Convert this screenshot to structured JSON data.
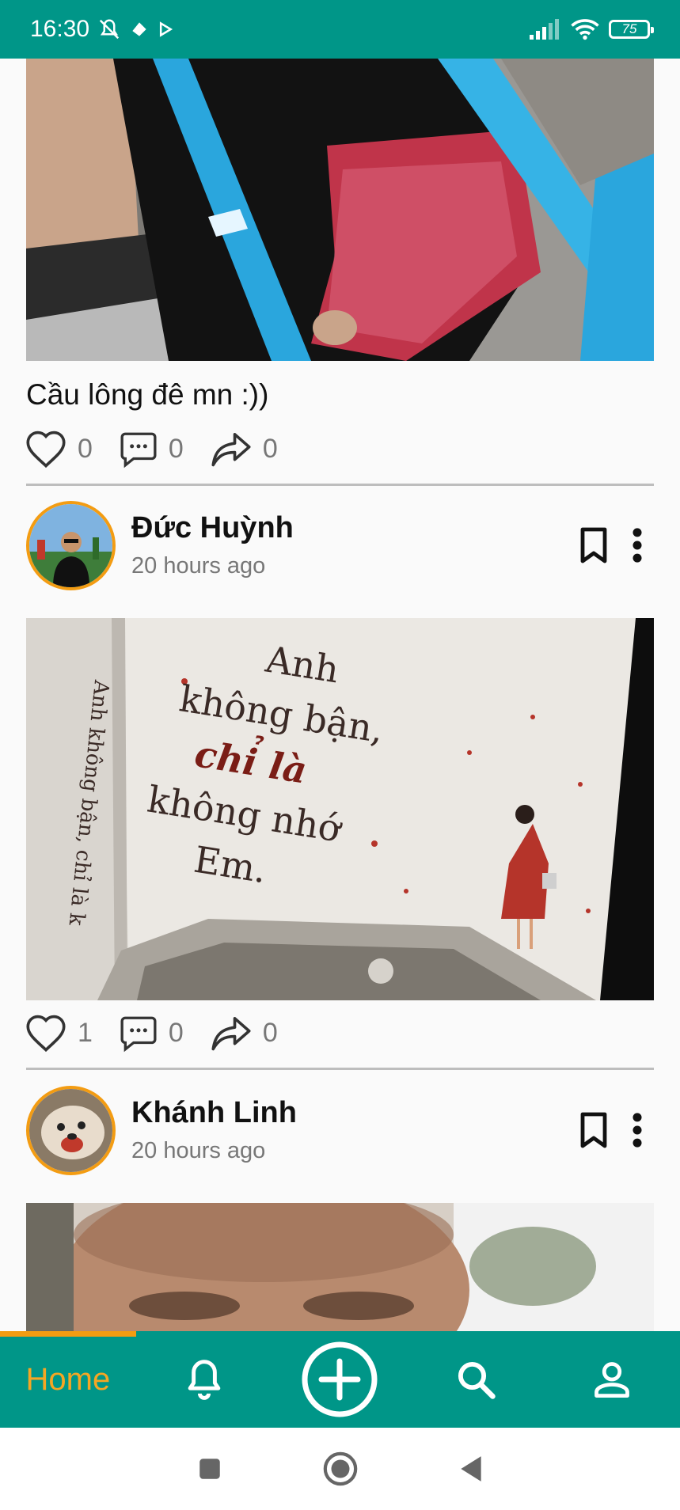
{
  "status_bar": {
    "time": "16:30",
    "battery": "75",
    "icons": [
      "mute-icon",
      "app-icon",
      "play-icon",
      "signal-icon",
      "wifi-icon",
      "battery-icon"
    ]
  },
  "posts": [
    {
      "caption": "Cầu lông đê mn :))",
      "likes": "0",
      "comments": "0",
      "shares": "0"
    },
    {
      "user": "Đức Huỳnh",
      "time": "20 hours ago",
      "image_text": {
        "line1": "Anh",
        "line2": "không bận,",
        "line3": "chỉ là",
        "line4": "không nhớ",
        "line5": "Em.",
        "spine": "Anh không bận, chỉ là k"
      },
      "likes": "1",
      "comments": "0",
      "shares": "0"
    },
    {
      "user": "Khánh Linh",
      "time": "20 hours ago"
    }
  ],
  "bottom_nav": {
    "active": "Home",
    "items": [
      "home",
      "notifications",
      "add",
      "search",
      "profile"
    ]
  },
  "colors": {
    "primary": "#009688",
    "accent": "#f39c12"
  }
}
